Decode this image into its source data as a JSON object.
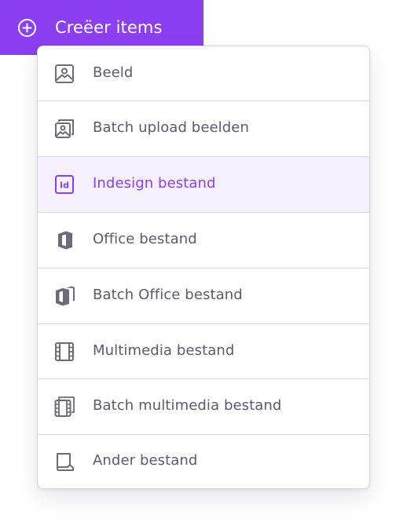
{
  "create_button": {
    "label": "Creëer items",
    "icon": "plus-circle-icon",
    "color": "#8c3ff0"
  },
  "menu": {
    "items": [
      {
        "label": "Beeld",
        "icon": "image-icon",
        "active": false
      },
      {
        "label": "Batch upload beelden",
        "icon": "images-stack-icon",
        "active": false
      },
      {
        "label": "Indesign bestand",
        "icon": "indesign-icon",
        "active": true
      },
      {
        "label": "Office bestand",
        "icon": "office-icon",
        "active": false
      },
      {
        "label": "Batch Office bestand",
        "icon": "office-stack-icon",
        "active": false
      },
      {
        "label": "Multimedia bestand",
        "icon": "film-icon",
        "active": false
      },
      {
        "label": "Batch multimedia bestand",
        "icon": "film-stack-icon",
        "active": false
      },
      {
        "label": "Ander bestand",
        "icon": "file-icon",
        "active": false
      }
    ]
  }
}
